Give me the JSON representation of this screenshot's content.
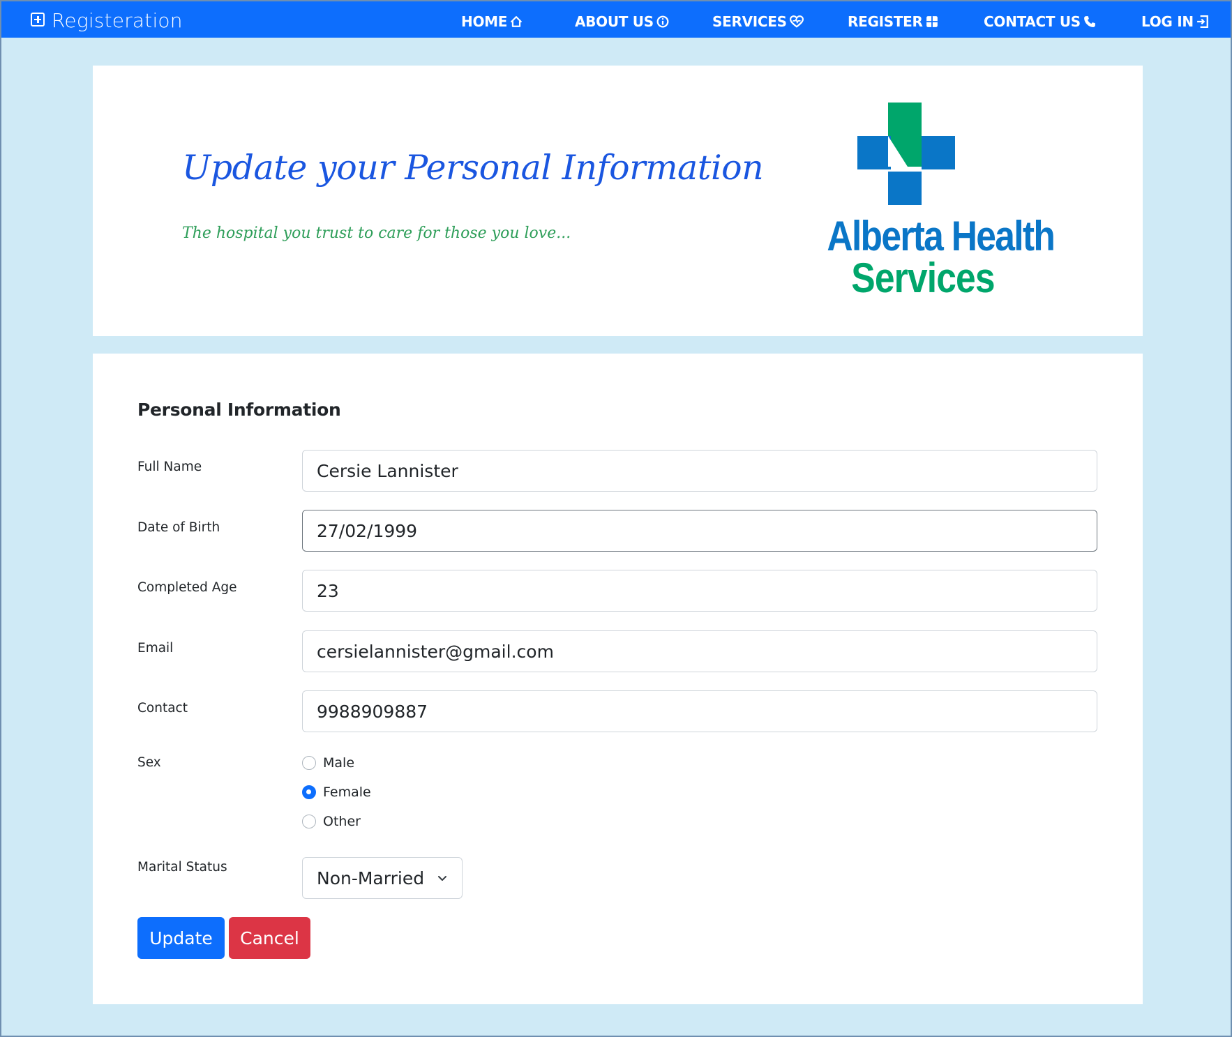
{
  "navbar": {
    "brand": "Registeration",
    "brand_icon": "plus-square-icon",
    "items": [
      {
        "label": "HOME",
        "icon": "house-icon"
      },
      {
        "label": "ABOUT US",
        "icon": "info-circle-icon"
      },
      {
        "label": "SERVICES",
        "icon": "heart-pulse-icon"
      },
      {
        "label": "REGISTER",
        "icon": "grid-plus-icon"
      },
      {
        "label": "CONTACT US",
        "icon": "phone-icon"
      },
      {
        "label": "LOG IN",
        "icon": "login-box-icon"
      }
    ],
    "color": "#0d6efd"
  },
  "hero": {
    "title": "Update your Personal Information",
    "subtitle": "The hospital you trust to care for those you love...",
    "logo": {
      "line1": "Alberta Health",
      "line2": "Services",
      "colors": {
        "blue": "#0a76c7",
        "green": "#00a66b"
      }
    }
  },
  "form": {
    "section_title": "Personal Information",
    "fields": {
      "full_name": {
        "label": "Full Name",
        "value": "Cersie Lannister"
      },
      "dob": {
        "label": "Date of Birth",
        "value": "27/02/1999"
      },
      "age": {
        "label": "Completed Age",
        "value": "23"
      },
      "email": {
        "label": "Email",
        "value": "cersielannister@gmail.com"
      },
      "contact": {
        "label": "Contact",
        "value": "9988909887"
      }
    },
    "sex": {
      "label": "Sex",
      "options": [
        "Male",
        "Female",
        "Other"
      ],
      "selected": "Female"
    },
    "marital": {
      "label": "Marital Status",
      "selected": "Non-Married"
    },
    "buttons": {
      "update": "Update",
      "cancel": "Cancel"
    },
    "colors": {
      "primary": "#0d6efd",
      "danger": "#dc3545"
    }
  },
  "page": {
    "background": "#cfeaf6"
  }
}
